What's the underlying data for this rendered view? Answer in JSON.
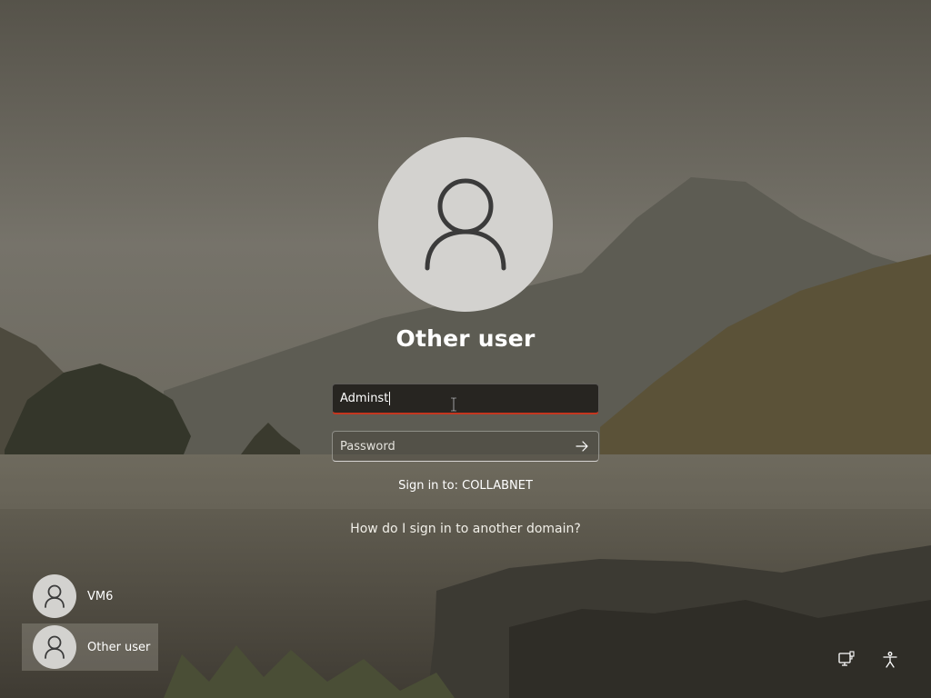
{
  "login": {
    "title": "Other user",
    "username_value": "Adminst",
    "password_placeholder": "Password",
    "sign_in_to": "Sign in to: COLLABNET",
    "domain_help_link": "How do I sign in to another domain?"
  },
  "user_tiles": [
    {
      "label": "VM6",
      "icon": "user-icon",
      "selected": false
    },
    {
      "label": "Other user",
      "icon": "user-icon",
      "selected": true
    }
  ],
  "corner_icons": [
    "network-icon",
    "accessibility-icon"
  ],
  "colors": {
    "avatar_bg": "#d3d2cf",
    "avatar_glyph": "#3b3b3b",
    "focus_underline": "#c5361f",
    "text": "#ffffff"
  }
}
